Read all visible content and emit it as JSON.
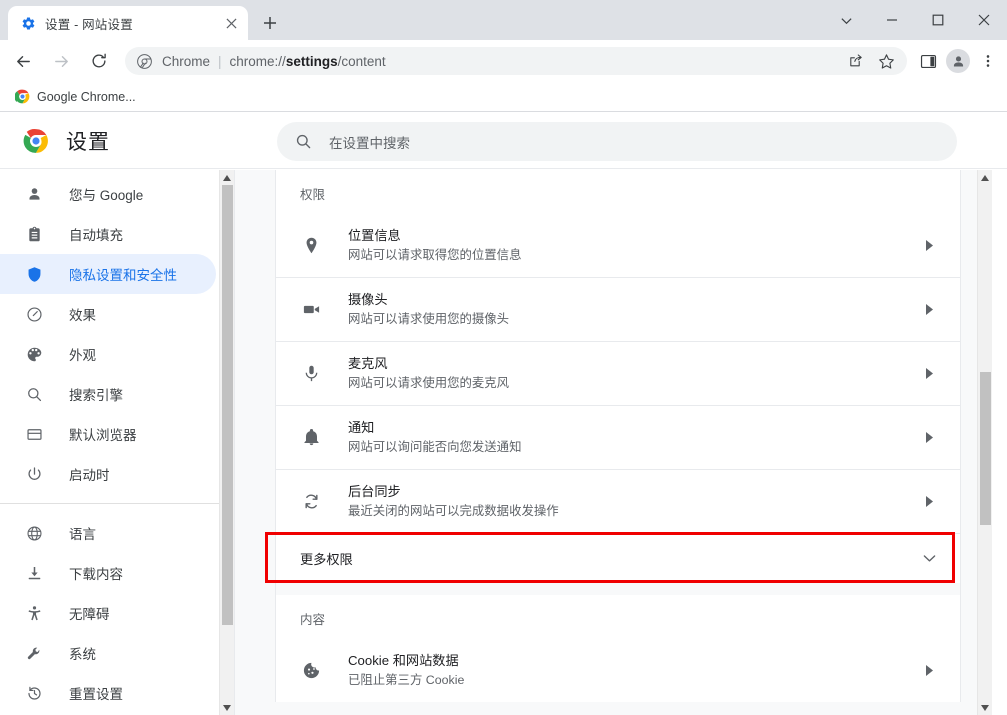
{
  "window": {
    "tab": {
      "title": "设置 - 网站设置",
      "favicon": "gear-icon",
      "close": "×"
    },
    "newtab_label": "+",
    "controls": {
      "minimize": "—",
      "maximize": "□",
      "close": "✕",
      "tab_search": "⌄"
    }
  },
  "toolbar": {
    "back": "←",
    "forward": "→",
    "reload": "⟳",
    "omnibox": {
      "security_icon": "chrome-icon",
      "scheme_label": "Chrome",
      "divider": "|",
      "url_prefix": "chrome://",
      "url_bold": "settings",
      "url_suffix": "/content"
    },
    "share": "share-icon",
    "bookmark": "star-icon",
    "side_panel": "side-panel-icon",
    "profile": "profile-icon",
    "menu": "⋮"
  },
  "bookmarks": [
    {
      "label": "Google Chrome...",
      "icon": "chrome-icon"
    }
  ],
  "settings": {
    "logo": "chrome-icon",
    "title": "设置",
    "search": {
      "placeholder": "在设置中搜索",
      "icon": "search-icon"
    }
  },
  "sidebar": {
    "groups": [
      {
        "items": [
          {
            "label": "您与 Google",
            "icon": "person-icon",
            "selected": false
          },
          {
            "label": "自动填充",
            "icon": "clipboard-icon",
            "selected": false
          },
          {
            "label": "隐私设置和安全性",
            "icon": "shield-icon",
            "selected": true
          },
          {
            "label": "效果",
            "icon": "speedometer-icon",
            "selected": false
          },
          {
            "label": "外观",
            "icon": "palette-icon",
            "selected": false
          },
          {
            "label": "搜索引擎",
            "icon": "search-icon",
            "selected": false
          },
          {
            "label": "默认浏览器",
            "icon": "browser-window-icon",
            "selected": false
          },
          {
            "label": "启动时",
            "icon": "power-icon",
            "selected": false
          }
        ]
      },
      {
        "items": [
          {
            "label": "语言",
            "icon": "globe-icon",
            "selected": false
          },
          {
            "label": "下载内容",
            "icon": "download-icon",
            "selected": false
          },
          {
            "label": "无障碍",
            "icon": "accessibility-icon",
            "selected": false
          },
          {
            "label": "系统",
            "icon": "wrench-icon",
            "selected": false
          },
          {
            "label": "重置设置",
            "icon": "history-restore-icon",
            "selected": false
          }
        ]
      }
    ]
  },
  "content": {
    "permissions_heading": "权限",
    "permissions": [
      {
        "icon": "location-pin-icon",
        "title": "位置信息",
        "sub": "网站可以请求取得您的位置信息",
        "arrow": "▸"
      },
      {
        "icon": "video-camera-icon",
        "title": "摄像头",
        "sub": "网站可以请求使用您的摄像头",
        "arrow": "▸"
      },
      {
        "icon": "microphone-icon",
        "title": "麦克风",
        "sub": "网站可以请求使用您的麦克风",
        "arrow": "▸"
      },
      {
        "icon": "bell-icon",
        "title": "通知",
        "sub": "网站可以询问能否向您发送通知",
        "arrow": "▸"
      },
      {
        "icon": "sync-icon",
        "title": "后台同步",
        "sub": "最近关闭的网站可以完成数据收发操作",
        "arrow": "▸"
      }
    ],
    "more_permissions": {
      "label": "更多权限",
      "chevron": "⌄",
      "highlighted": true
    },
    "content_heading": "内容",
    "content_items": [
      {
        "icon": "cookie-icon",
        "title": "Cookie 和网站数据",
        "sub": "已阻止第三方 Cookie",
        "arrow": "▸"
      }
    ]
  },
  "colors": {
    "accent": "#1a73e8",
    "accent_bg": "#e8f0fe",
    "highlight_box": "#f00000",
    "tabstrip_bg": "#dee1e6",
    "page_bg": "#f8f9fa"
  }
}
